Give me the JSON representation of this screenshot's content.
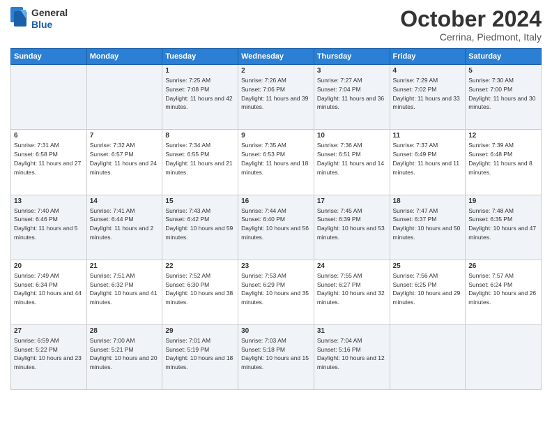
{
  "header": {
    "logo": {
      "general": "General",
      "blue": "Blue"
    },
    "title": "October 2024",
    "subtitle": "Cerrina, Piedmont, Italy"
  },
  "weekdays": [
    "Sunday",
    "Monday",
    "Tuesday",
    "Wednesday",
    "Thursday",
    "Friday",
    "Saturday"
  ],
  "weeks": [
    [
      {
        "day": "",
        "sunrise": "",
        "sunset": "",
        "daylight": ""
      },
      {
        "day": "",
        "sunrise": "",
        "sunset": "",
        "daylight": ""
      },
      {
        "day": "1",
        "sunrise": "Sunrise: 7:25 AM",
        "sunset": "Sunset: 7:08 PM",
        "daylight": "Daylight: 11 hours and 42 minutes."
      },
      {
        "day": "2",
        "sunrise": "Sunrise: 7:26 AM",
        "sunset": "Sunset: 7:06 PM",
        "daylight": "Daylight: 11 hours and 39 minutes."
      },
      {
        "day": "3",
        "sunrise": "Sunrise: 7:27 AM",
        "sunset": "Sunset: 7:04 PM",
        "daylight": "Daylight: 11 hours and 36 minutes."
      },
      {
        "day": "4",
        "sunrise": "Sunrise: 7:29 AM",
        "sunset": "Sunset: 7:02 PM",
        "daylight": "Daylight: 11 hours and 33 minutes."
      },
      {
        "day": "5",
        "sunrise": "Sunrise: 7:30 AM",
        "sunset": "Sunset: 7:00 PM",
        "daylight": "Daylight: 11 hours and 30 minutes."
      }
    ],
    [
      {
        "day": "6",
        "sunrise": "Sunrise: 7:31 AM",
        "sunset": "Sunset: 6:58 PM",
        "daylight": "Daylight: 11 hours and 27 minutes."
      },
      {
        "day": "7",
        "sunrise": "Sunrise: 7:32 AM",
        "sunset": "Sunset: 6:57 PM",
        "daylight": "Daylight: 11 hours and 24 minutes."
      },
      {
        "day": "8",
        "sunrise": "Sunrise: 7:34 AM",
        "sunset": "Sunset: 6:55 PM",
        "daylight": "Daylight: 11 hours and 21 minutes."
      },
      {
        "day": "9",
        "sunrise": "Sunrise: 7:35 AM",
        "sunset": "Sunset: 6:53 PM",
        "daylight": "Daylight: 11 hours and 18 minutes."
      },
      {
        "day": "10",
        "sunrise": "Sunrise: 7:36 AM",
        "sunset": "Sunset: 6:51 PM",
        "daylight": "Daylight: 11 hours and 14 minutes."
      },
      {
        "day": "11",
        "sunrise": "Sunrise: 7:37 AM",
        "sunset": "Sunset: 6:49 PM",
        "daylight": "Daylight: 11 hours and 11 minutes."
      },
      {
        "day": "12",
        "sunrise": "Sunrise: 7:39 AM",
        "sunset": "Sunset: 6:48 PM",
        "daylight": "Daylight: 11 hours and 8 minutes."
      }
    ],
    [
      {
        "day": "13",
        "sunrise": "Sunrise: 7:40 AM",
        "sunset": "Sunset: 6:46 PM",
        "daylight": "Daylight: 11 hours and 5 minutes."
      },
      {
        "day": "14",
        "sunrise": "Sunrise: 7:41 AM",
        "sunset": "Sunset: 6:44 PM",
        "daylight": "Daylight: 11 hours and 2 minutes."
      },
      {
        "day": "15",
        "sunrise": "Sunrise: 7:43 AM",
        "sunset": "Sunset: 6:42 PM",
        "daylight": "Daylight: 10 hours and 59 minutes."
      },
      {
        "day": "16",
        "sunrise": "Sunrise: 7:44 AM",
        "sunset": "Sunset: 6:40 PM",
        "daylight": "Daylight: 10 hours and 56 minutes."
      },
      {
        "day": "17",
        "sunrise": "Sunrise: 7:45 AM",
        "sunset": "Sunset: 6:39 PM",
        "daylight": "Daylight: 10 hours and 53 minutes."
      },
      {
        "day": "18",
        "sunrise": "Sunrise: 7:47 AM",
        "sunset": "Sunset: 6:37 PM",
        "daylight": "Daylight: 10 hours and 50 minutes."
      },
      {
        "day": "19",
        "sunrise": "Sunrise: 7:48 AM",
        "sunset": "Sunset: 6:35 PM",
        "daylight": "Daylight: 10 hours and 47 minutes."
      }
    ],
    [
      {
        "day": "20",
        "sunrise": "Sunrise: 7:49 AM",
        "sunset": "Sunset: 6:34 PM",
        "daylight": "Daylight: 10 hours and 44 minutes."
      },
      {
        "day": "21",
        "sunrise": "Sunrise: 7:51 AM",
        "sunset": "Sunset: 6:32 PM",
        "daylight": "Daylight: 10 hours and 41 minutes."
      },
      {
        "day": "22",
        "sunrise": "Sunrise: 7:52 AM",
        "sunset": "Sunset: 6:30 PM",
        "daylight": "Daylight: 10 hours and 38 minutes."
      },
      {
        "day": "23",
        "sunrise": "Sunrise: 7:53 AM",
        "sunset": "Sunset: 6:29 PM",
        "daylight": "Daylight: 10 hours and 35 minutes."
      },
      {
        "day": "24",
        "sunrise": "Sunrise: 7:55 AM",
        "sunset": "Sunset: 6:27 PM",
        "daylight": "Daylight: 10 hours and 32 minutes."
      },
      {
        "day": "25",
        "sunrise": "Sunrise: 7:56 AM",
        "sunset": "Sunset: 6:25 PM",
        "daylight": "Daylight: 10 hours and 29 minutes."
      },
      {
        "day": "26",
        "sunrise": "Sunrise: 7:57 AM",
        "sunset": "Sunset: 6:24 PM",
        "daylight": "Daylight: 10 hours and 26 minutes."
      }
    ],
    [
      {
        "day": "27",
        "sunrise": "Sunrise: 6:59 AM",
        "sunset": "Sunset: 5:22 PM",
        "daylight": "Daylight: 10 hours and 23 minutes."
      },
      {
        "day": "28",
        "sunrise": "Sunrise: 7:00 AM",
        "sunset": "Sunset: 5:21 PM",
        "daylight": "Daylight: 10 hours and 20 minutes."
      },
      {
        "day": "29",
        "sunrise": "Sunrise: 7:01 AM",
        "sunset": "Sunset: 5:19 PM",
        "daylight": "Daylight: 10 hours and 18 minutes."
      },
      {
        "day": "30",
        "sunrise": "Sunrise: 7:03 AM",
        "sunset": "Sunset: 5:18 PM",
        "daylight": "Daylight: 10 hours and 15 minutes."
      },
      {
        "day": "31",
        "sunrise": "Sunrise: 7:04 AM",
        "sunset": "Sunset: 5:16 PM",
        "daylight": "Daylight: 10 hours and 12 minutes."
      },
      {
        "day": "",
        "sunrise": "",
        "sunset": "",
        "daylight": ""
      },
      {
        "day": "",
        "sunrise": "",
        "sunset": "",
        "daylight": ""
      }
    ]
  ]
}
